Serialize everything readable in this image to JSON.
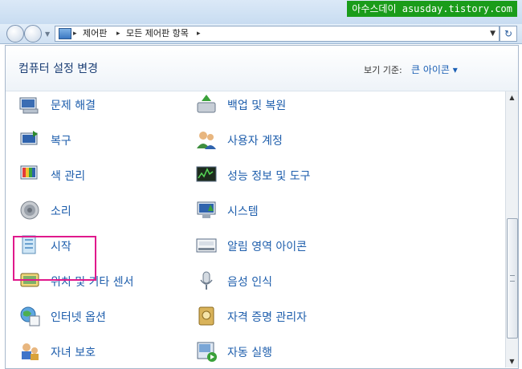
{
  "watermark": "아수스데이 asusday.tistory.com",
  "breadcrumb": [
    "제어판",
    "모든 제어판 항목"
  ],
  "header": {
    "title": "컴퓨터 설정 변경",
    "view_label": "보기 기준:",
    "view_value": "큰 아이콘 ▾"
  },
  "items": [
    {
      "label": "문제 해결",
      "icon": "troubleshoot-icon"
    },
    {
      "label": "백업 및 복원",
      "icon": "backup-restore-icon"
    },
    {
      "label": "복구",
      "icon": "recovery-icon"
    },
    {
      "label": "사용자 계정",
      "icon": "user-accounts-icon"
    },
    {
      "label": "색 관리",
      "icon": "color-management-icon"
    },
    {
      "label": "성능 정보 및 도구",
      "icon": "performance-icon"
    },
    {
      "label": "소리",
      "icon": "sound-icon"
    },
    {
      "label": "시스템",
      "icon": "system-icon"
    },
    {
      "label": "시작",
      "icon": "getting-started-icon"
    },
    {
      "label": "알림 영역 아이콘",
      "icon": "notification-area-icon"
    },
    {
      "label": "위치 및 기타 센서",
      "icon": "location-sensors-icon"
    },
    {
      "label": "음성 인식",
      "icon": "speech-recognition-icon"
    },
    {
      "label": "인터넷 옵션",
      "icon": "internet-options-icon"
    },
    {
      "label": "자격 증명 관리자",
      "icon": "credential-manager-icon"
    },
    {
      "label": "자녀 보호",
      "icon": "parental-controls-icon"
    },
    {
      "label": "자동 실행",
      "icon": "autoplay-icon"
    }
  ],
  "highlighted_item": "소리"
}
